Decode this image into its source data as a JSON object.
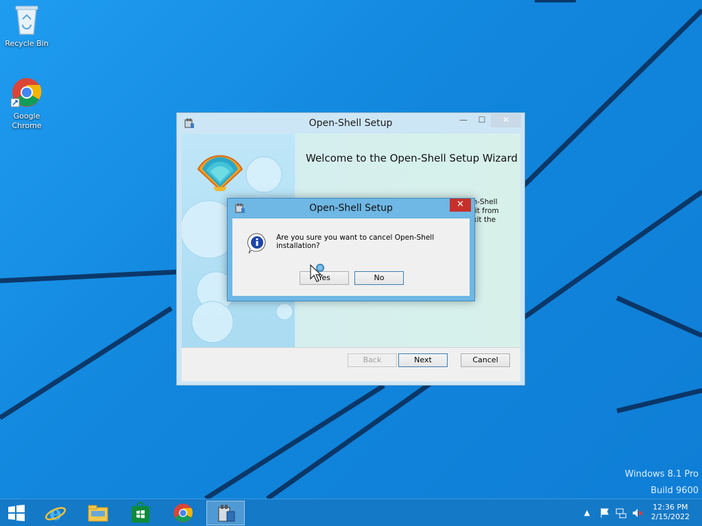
{
  "desktop": {
    "icons": [
      {
        "label": "Recycle Bin"
      },
      {
        "label": "Google\nChrome"
      }
    ],
    "watermark": {
      "line1": "Windows 8.1 Pro",
      "line2": "Build 9600"
    }
  },
  "main_window": {
    "title": "Open-Shell Setup",
    "welcome": "Welcome to the Open-Shell Setup Wizard",
    "body_fragment": "en-Shell\ne it from\nexit the",
    "buttons": {
      "back": "Back",
      "next": "Next",
      "cancel": "Cancel"
    },
    "caption": {
      "minimize": "—",
      "maximize": "☐",
      "close": "✕"
    }
  },
  "dialog": {
    "title": "Open-Shell Setup",
    "message": "Are you sure you want to cancel Open-Shell installation?",
    "close": "✕",
    "yes": "Yes",
    "no": "No"
  },
  "taskbar": {
    "items": [
      "start-icon",
      "internet-explorer-icon",
      "file-explorer-icon",
      "store-icon",
      "chrome-icon",
      "setup-icon"
    ],
    "time": "12:36 PM",
    "date": "2/15/2022"
  }
}
